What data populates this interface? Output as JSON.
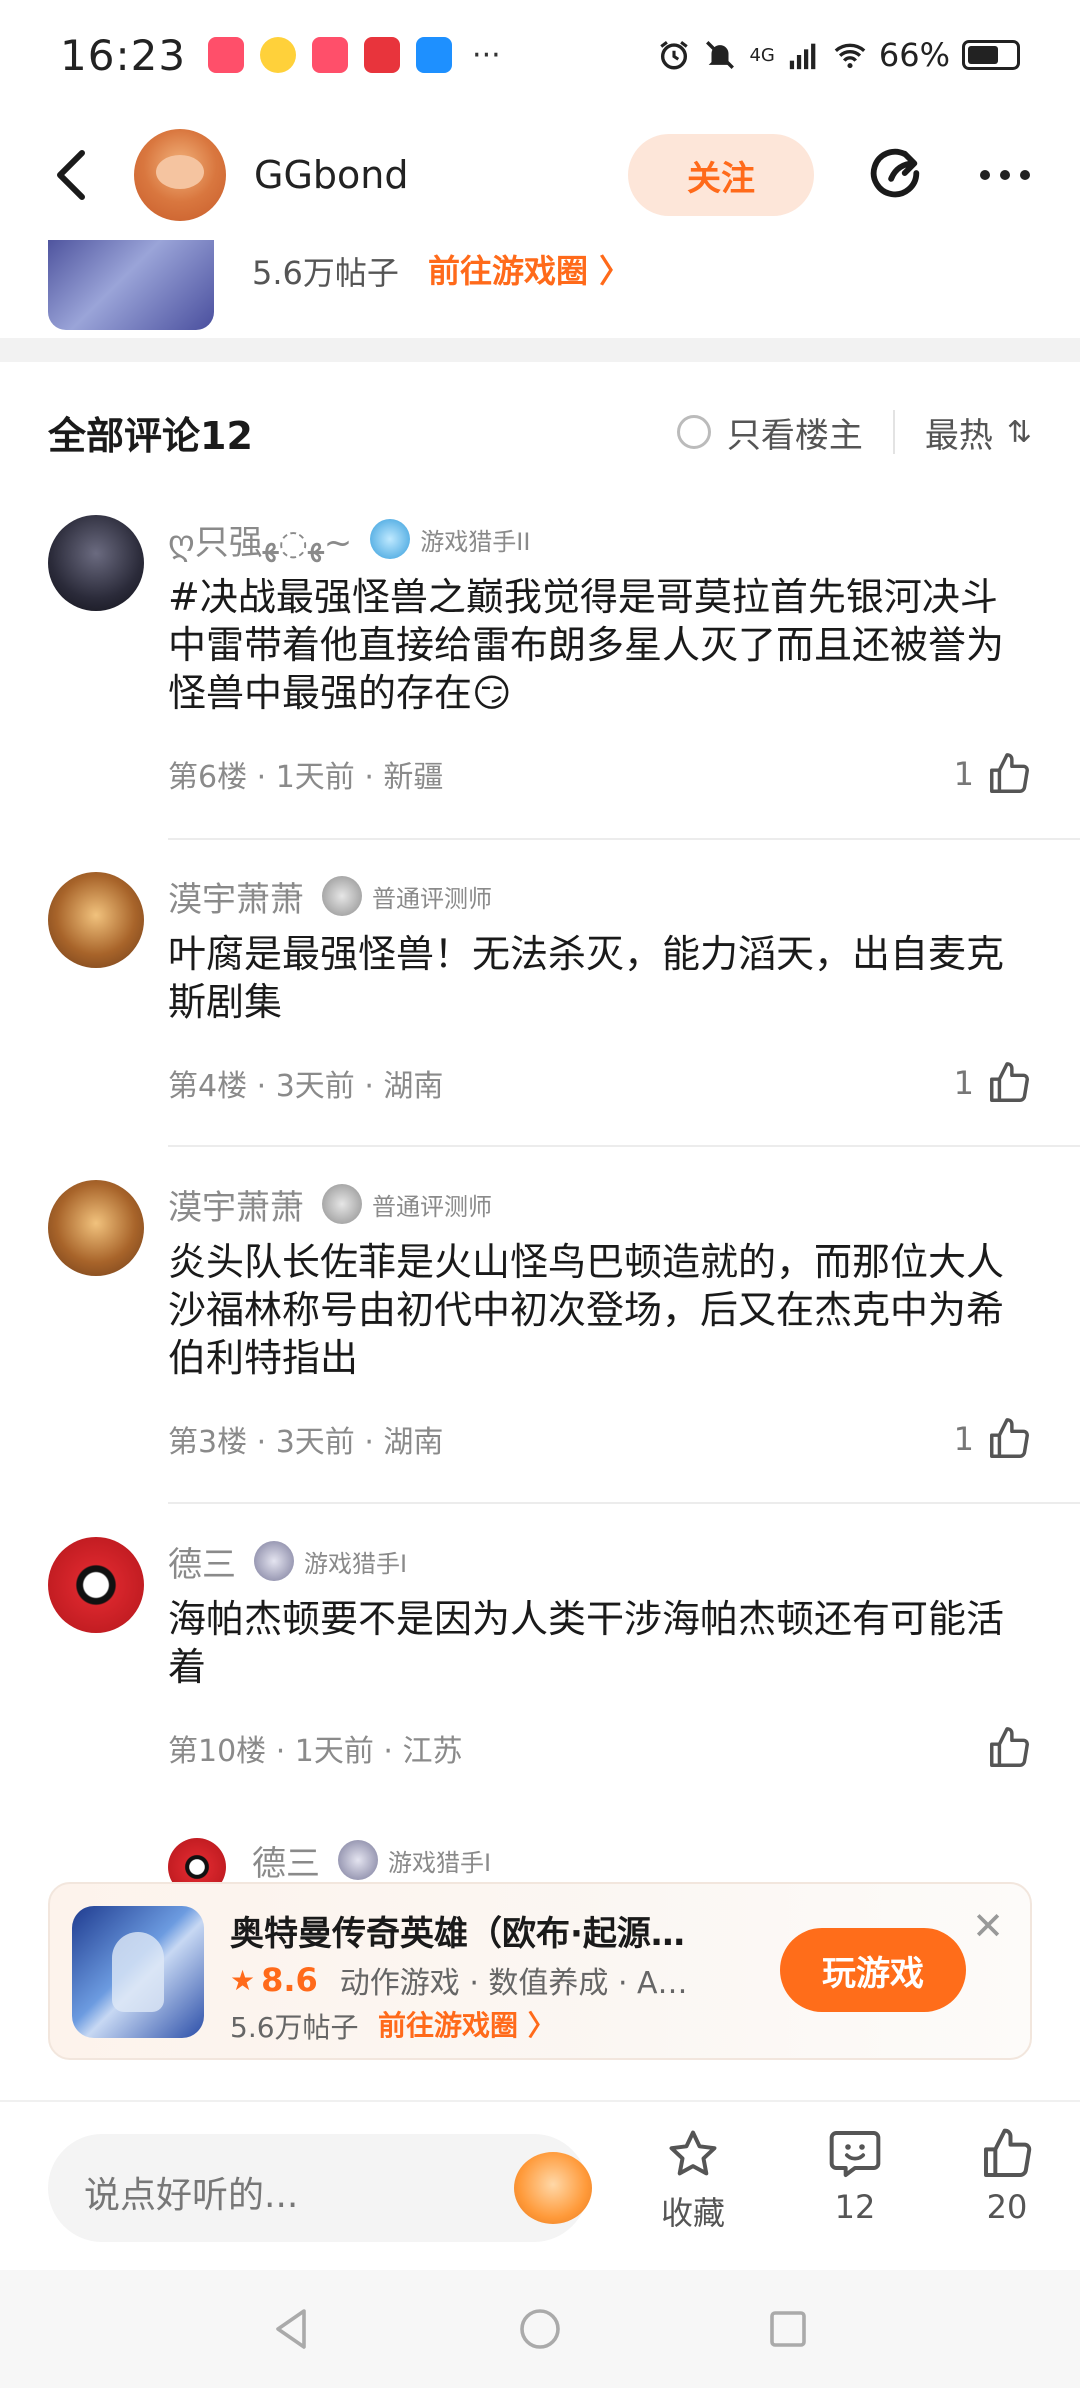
{
  "status_bar": {
    "time": "16:23",
    "app_icons": [
      "xiaohongshu-icon",
      "weibo-icon",
      "xiaohongshu-icon",
      "game-app-icon",
      "messages-icon"
    ],
    "more": "···",
    "network": "4G",
    "battery": "66%",
    "battery_level": 0.66
  },
  "header": {
    "username": "GGbond",
    "follow_label": "关注"
  },
  "peek": {
    "post_count": "5.6万帖子",
    "link": "前往游戏圈 〉"
  },
  "comments_header": {
    "title": "全部评论12",
    "owner_only": "只看楼主",
    "sort": "最热",
    "sort_icon": "⇅"
  },
  "comments": [
    {
      "name": "ღ只强ﻬ◌ﻬ~",
      "badge": "游戏猎手II",
      "text": "#决战最强怪兽之巅我觉得是哥莫拉首先银河决斗中雷带着他直接给雷布朗多星人灭了而且还被誉为怪兽中最强的存在😏",
      "meta": "第6楼 · 1天前 · 新疆",
      "likes": "1"
    },
    {
      "name": "漠宇萧萧",
      "badge": "普通评测师",
      "text": "叶腐是最强怪兽！无法杀灭，能力滔天，出自麦克斯剧集",
      "meta": "第4楼 · 3天前 · 湖南",
      "likes": "1"
    },
    {
      "name": "漠宇萧萧",
      "badge": "普通评测师",
      "text": "炎头队长佐菲是火山怪鸟巴顿造就的，而那位大人沙福林称号由初代中初次登场，后又在杰克中为希伯利特指出",
      "meta": "第3楼 · 3天前 · 湖南",
      "likes": "1"
    },
    {
      "name": "德三",
      "badge": "游戏猎手I",
      "text": "海帕杰顿要不是因为人类干涉海帕杰顿还有可能活着",
      "meta": "第10楼 · 1天前 · 江苏",
      "likes": ""
    }
  ],
  "reply_peek": {
    "name": "德三",
    "badge": "游戏猎手I"
  },
  "game_card": {
    "title": "奥特曼传奇英雄（欧布·起源…",
    "rating": "8.6",
    "tags": "动作游戏 · 数值养成 · A…",
    "post_count": "5.6万帖子",
    "link": "前往游戏圈 〉",
    "play_label": "玩游戏",
    "close": "✕"
  },
  "bottom_bar": {
    "input_placeholder": "说点好听的...",
    "favorite_label": "收藏",
    "comment_count": "12",
    "like_count": "20"
  },
  "colors": {
    "accent": "#ff6a1a",
    "follow_bg": "#fde6d9",
    "muted": "#8a8a8a"
  }
}
